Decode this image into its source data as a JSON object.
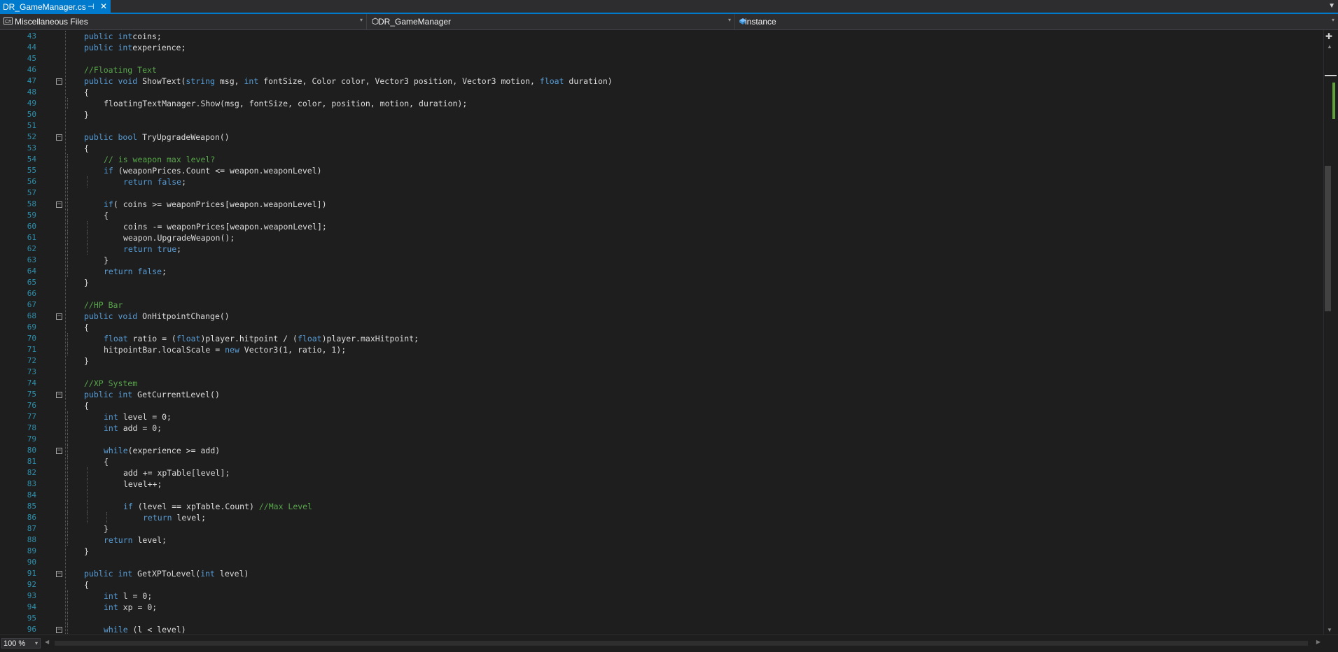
{
  "tab": {
    "title": "DR_GameManager.cs",
    "pin_glyph": "⊣",
    "close_glyph": "✕"
  },
  "navbar": {
    "project": "Miscellaneous Files",
    "type": "DR_GameManager",
    "member": "instance"
  },
  "editor": {
    "lines": [
      {
        "n": "43",
        "indent": 1,
        "tokens": [
          [
            "kw",
            "public "
          ],
          [
            "kw",
            "int"
          ],
          [
            "",
            "coins;"
          ]
        ]
      },
      {
        "n": "44",
        "indent": 1,
        "tokens": [
          [
            "kw",
            "public "
          ],
          [
            "kw",
            "int"
          ],
          [
            "",
            "experience;"
          ]
        ]
      },
      {
        "n": "45",
        "indent": 1,
        "tokens": []
      },
      {
        "n": "46",
        "indent": 1,
        "tokens": [
          [
            "cm",
            "//Floating Text"
          ]
        ]
      },
      {
        "n": "47",
        "indent": 1,
        "tokens": [
          [
            "kw",
            "public "
          ],
          [
            "kw",
            "void "
          ],
          [
            "",
            "ShowText("
          ],
          [
            "kw",
            "string "
          ],
          [
            "",
            "msg, "
          ],
          [
            "kw",
            "int "
          ],
          [
            "",
            "fontSize, Color color, Vector3 position, Vector3 motion, "
          ],
          [
            "kw",
            "float "
          ],
          [
            "",
            "duration)"
          ]
        ]
      },
      {
        "n": "48",
        "indent": 1,
        "tokens": [
          [
            "",
            "{"
          ]
        ]
      },
      {
        "n": "49",
        "indent": 2,
        "tokens": [
          [
            "",
            "floatingTextManager.Show(msg, fontSize, color, position, motion, duration);"
          ]
        ]
      },
      {
        "n": "50",
        "indent": 1,
        "tokens": [
          [
            "",
            "}"
          ]
        ]
      },
      {
        "n": "51",
        "indent": 1,
        "tokens": []
      },
      {
        "n": "52",
        "indent": 1,
        "tokens": [
          [
            "kw",
            "public "
          ],
          [
            "kw",
            "bool "
          ],
          [
            "",
            "TryUpgradeWeapon()"
          ]
        ]
      },
      {
        "n": "53",
        "indent": 1,
        "tokens": [
          [
            "",
            "{"
          ]
        ]
      },
      {
        "n": "54",
        "indent": 2,
        "tokens": [
          [
            "cm",
            "// is weapon max level?"
          ]
        ]
      },
      {
        "n": "55",
        "indent": 2,
        "tokens": [
          [
            "kw",
            "if "
          ],
          [
            "",
            "(weaponPrices.Count <= weapon.weaponLevel)"
          ]
        ]
      },
      {
        "n": "56",
        "indent": 3,
        "tokens": [
          [
            "kw",
            "return "
          ],
          [
            "kw",
            "false"
          ],
          [
            "",
            ";"
          ]
        ]
      },
      {
        "n": "57",
        "indent": 2,
        "tokens": []
      },
      {
        "n": "58",
        "indent": 2,
        "tokens": [
          [
            "kw",
            "if"
          ],
          [
            "",
            "( coins >= weaponPrices[weapon.weaponLevel])"
          ]
        ]
      },
      {
        "n": "59",
        "indent": 2,
        "tokens": [
          [
            "",
            "{"
          ]
        ]
      },
      {
        "n": "60",
        "indent": 3,
        "tokens": [
          [
            "",
            "coins -= weaponPrices[weapon.weaponLevel];"
          ]
        ]
      },
      {
        "n": "61",
        "indent": 3,
        "tokens": [
          [
            "",
            "weapon.UpgradeWeapon();"
          ]
        ]
      },
      {
        "n": "62",
        "indent": 3,
        "tokens": [
          [
            "kw",
            "return "
          ],
          [
            "kw",
            "true"
          ],
          [
            "",
            ";"
          ]
        ]
      },
      {
        "n": "63",
        "indent": 2,
        "tokens": [
          [
            "",
            "}"
          ]
        ]
      },
      {
        "n": "64",
        "indent": 2,
        "tokens": [
          [
            "kw",
            "return "
          ],
          [
            "kw",
            "false"
          ],
          [
            "",
            ";"
          ]
        ]
      },
      {
        "n": "65",
        "indent": 1,
        "tokens": [
          [
            "",
            "}"
          ]
        ]
      },
      {
        "n": "66",
        "indent": 1,
        "tokens": []
      },
      {
        "n": "67",
        "indent": 1,
        "tokens": [
          [
            "cm",
            "//HP Bar"
          ]
        ]
      },
      {
        "n": "68",
        "indent": 1,
        "tokens": [
          [
            "kw",
            "public "
          ],
          [
            "kw",
            "void "
          ],
          [
            "",
            "OnHitpointChange()"
          ]
        ]
      },
      {
        "n": "69",
        "indent": 1,
        "tokens": [
          [
            "",
            "{"
          ]
        ]
      },
      {
        "n": "70",
        "indent": 2,
        "tokens": [
          [
            "kw",
            "float "
          ],
          [
            "",
            "ratio = ("
          ],
          [
            "kw",
            "float"
          ],
          [
            "",
            ")player.hitpoint / ("
          ],
          [
            "kw",
            "float"
          ],
          [
            "",
            ")player.maxHitpoint;"
          ]
        ]
      },
      {
        "n": "71",
        "indent": 2,
        "tokens": [
          [
            "",
            "hitpointBar.localScale = "
          ],
          [
            "kw",
            "new "
          ],
          [
            "",
            "Vector3(1, ratio, 1);"
          ]
        ]
      },
      {
        "n": "72",
        "indent": 1,
        "tokens": [
          [
            "",
            "}"
          ]
        ]
      },
      {
        "n": "73",
        "indent": 1,
        "tokens": []
      },
      {
        "n": "74",
        "indent": 1,
        "tokens": [
          [
            "cm",
            "//XP System"
          ]
        ]
      },
      {
        "n": "75",
        "indent": 1,
        "tokens": [
          [
            "kw",
            "public "
          ],
          [
            "kw",
            "int "
          ],
          [
            "",
            "GetCurrentLevel()"
          ]
        ]
      },
      {
        "n": "76",
        "indent": 1,
        "tokens": [
          [
            "",
            "{"
          ]
        ]
      },
      {
        "n": "77",
        "indent": 2,
        "tokens": [
          [
            "kw",
            "int "
          ],
          [
            "",
            "level = 0;"
          ]
        ]
      },
      {
        "n": "78",
        "indent": 2,
        "tokens": [
          [
            "kw",
            "int "
          ],
          [
            "",
            "add = 0;"
          ]
        ]
      },
      {
        "n": "79",
        "indent": 2,
        "tokens": []
      },
      {
        "n": "80",
        "indent": 2,
        "tokens": [
          [
            "kw",
            "while"
          ],
          [
            "",
            "(experience >= add)"
          ]
        ]
      },
      {
        "n": "81",
        "indent": 2,
        "tokens": [
          [
            "",
            "{"
          ]
        ]
      },
      {
        "n": "82",
        "indent": 3,
        "tokens": [
          [
            "",
            "add += xpTable[level];"
          ]
        ]
      },
      {
        "n": "83",
        "indent": 3,
        "tokens": [
          [
            "",
            "level++;"
          ]
        ]
      },
      {
        "n": "84",
        "indent": 3,
        "tokens": []
      },
      {
        "n": "85",
        "indent": 3,
        "tokens": [
          [
            "kw",
            "if "
          ],
          [
            "",
            "(level == xpTable.Count) "
          ],
          [
            "cm",
            "//Max Level"
          ]
        ]
      },
      {
        "n": "86",
        "indent": 4,
        "tokens": [
          [
            "kw",
            "return "
          ],
          [
            "",
            "level;"
          ]
        ]
      },
      {
        "n": "87",
        "indent": 2,
        "tokens": [
          [
            "",
            "}"
          ]
        ]
      },
      {
        "n": "88",
        "indent": 2,
        "tokens": [
          [
            "kw",
            "return "
          ],
          [
            "",
            "level;"
          ]
        ]
      },
      {
        "n": "89",
        "indent": 1,
        "tokens": [
          [
            "",
            "}"
          ]
        ]
      },
      {
        "n": "90",
        "indent": 1,
        "tokens": []
      },
      {
        "n": "91",
        "indent": 1,
        "tokens": [
          [
            "kw",
            "public "
          ],
          [
            "kw",
            "int "
          ],
          [
            "",
            "GetXPToLevel("
          ],
          [
            "kw",
            "int "
          ],
          [
            "",
            "level)"
          ]
        ]
      },
      {
        "n": "92",
        "indent": 1,
        "tokens": [
          [
            "",
            "{"
          ]
        ]
      },
      {
        "n": "93",
        "indent": 2,
        "tokens": [
          [
            "kw",
            "int "
          ],
          [
            "",
            "l = 0;"
          ]
        ]
      },
      {
        "n": "94",
        "indent": 2,
        "tokens": [
          [
            "kw",
            "int "
          ],
          [
            "",
            "xp = 0;"
          ]
        ]
      },
      {
        "n": "95",
        "indent": 2,
        "tokens": []
      },
      {
        "n": "96",
        "indent": 2,
        "tokens": [
          [
            "kw",
            "while "
          ],
          [
            "",
            "(l < level)"
          ]
        ]
      }
    ],
    "fold_lines": [
      "47",
      "52",
      "58",
      "68",
      "75",
      "80",
      "91",
      "96"
    ]
  },
  "statusbar": {
    "zoom": "100 %"
  },
  "colors": {
    "accent": "#007acc",
    "keyword": "#569cd6",
    "comment": "#57a64a",
    "linenumber": "#2b91af",
    "background": "#1e1e1e"
  },
  "icons": [
    "pin-icon",
    "close-icon",
    "cs-file-icon",
    "class-icon",
    "field-icon",
    "dropdown-icon",
    "split-icon"
  ]
}
